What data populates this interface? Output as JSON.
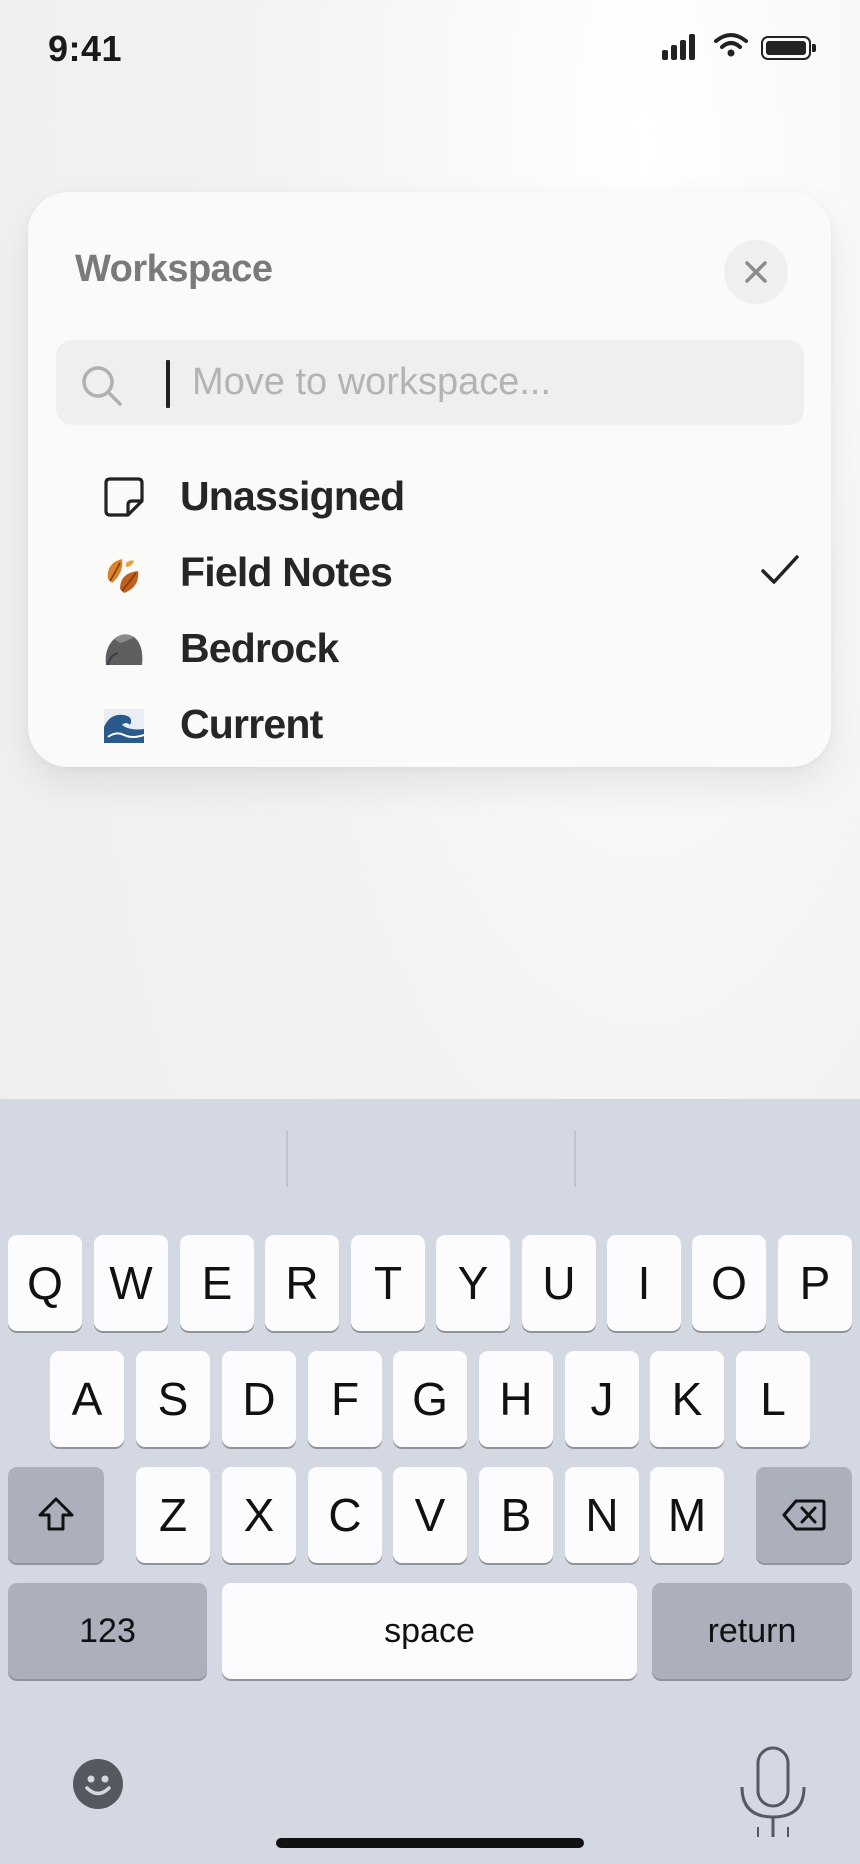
{
  "status": {
    "time": "9:41"
  },
  "popover": {
    "title": "Workspace",
    "search_placeholder": "Move to workspace...",
    "items": [
      {
        "label": "Unassigned",
        "icon": "sticky-note-icon",
        "selected": false
      },
      {
        "label": "Field Notes",
        "icon": "fallen-leaf-emoji",
        "selected": true
      },
      {
        "label": "Bedrock",
        "icon": "rock-emoji",
        "selected": false
      },
      {
        "label": "Current",
        "icon": "water-wave-emoji",
        "selected": false
      }
    ]
  },
  "keyboard": {
    "row1": [
      "Q",
      "W",
      "E",
      "R",
      "T",
      "Y",
      "U",
      "I",
      "O",
      "P"
    ],
    "row2": [
      "A",
      "S",
      "D",
      "F",
      "G",
      "H",
      "J",
      "K",
      "L"
    ],
    "row3": [
      "Z",
      "X",
      "C",
      "V",
      "B",
      "N",
      "M"
    ],
    "numbers_label": "123",
    "space_label": "space",
    "return_label": "return"
  },
  "colors": {
    "background": "#eeeeec",
    "card": "#fafaf8",
    "keyboard": "#d4d8e2",
    "key": "#fcfcfe",
    "key_dark": "#abb0bc"
  }
}
